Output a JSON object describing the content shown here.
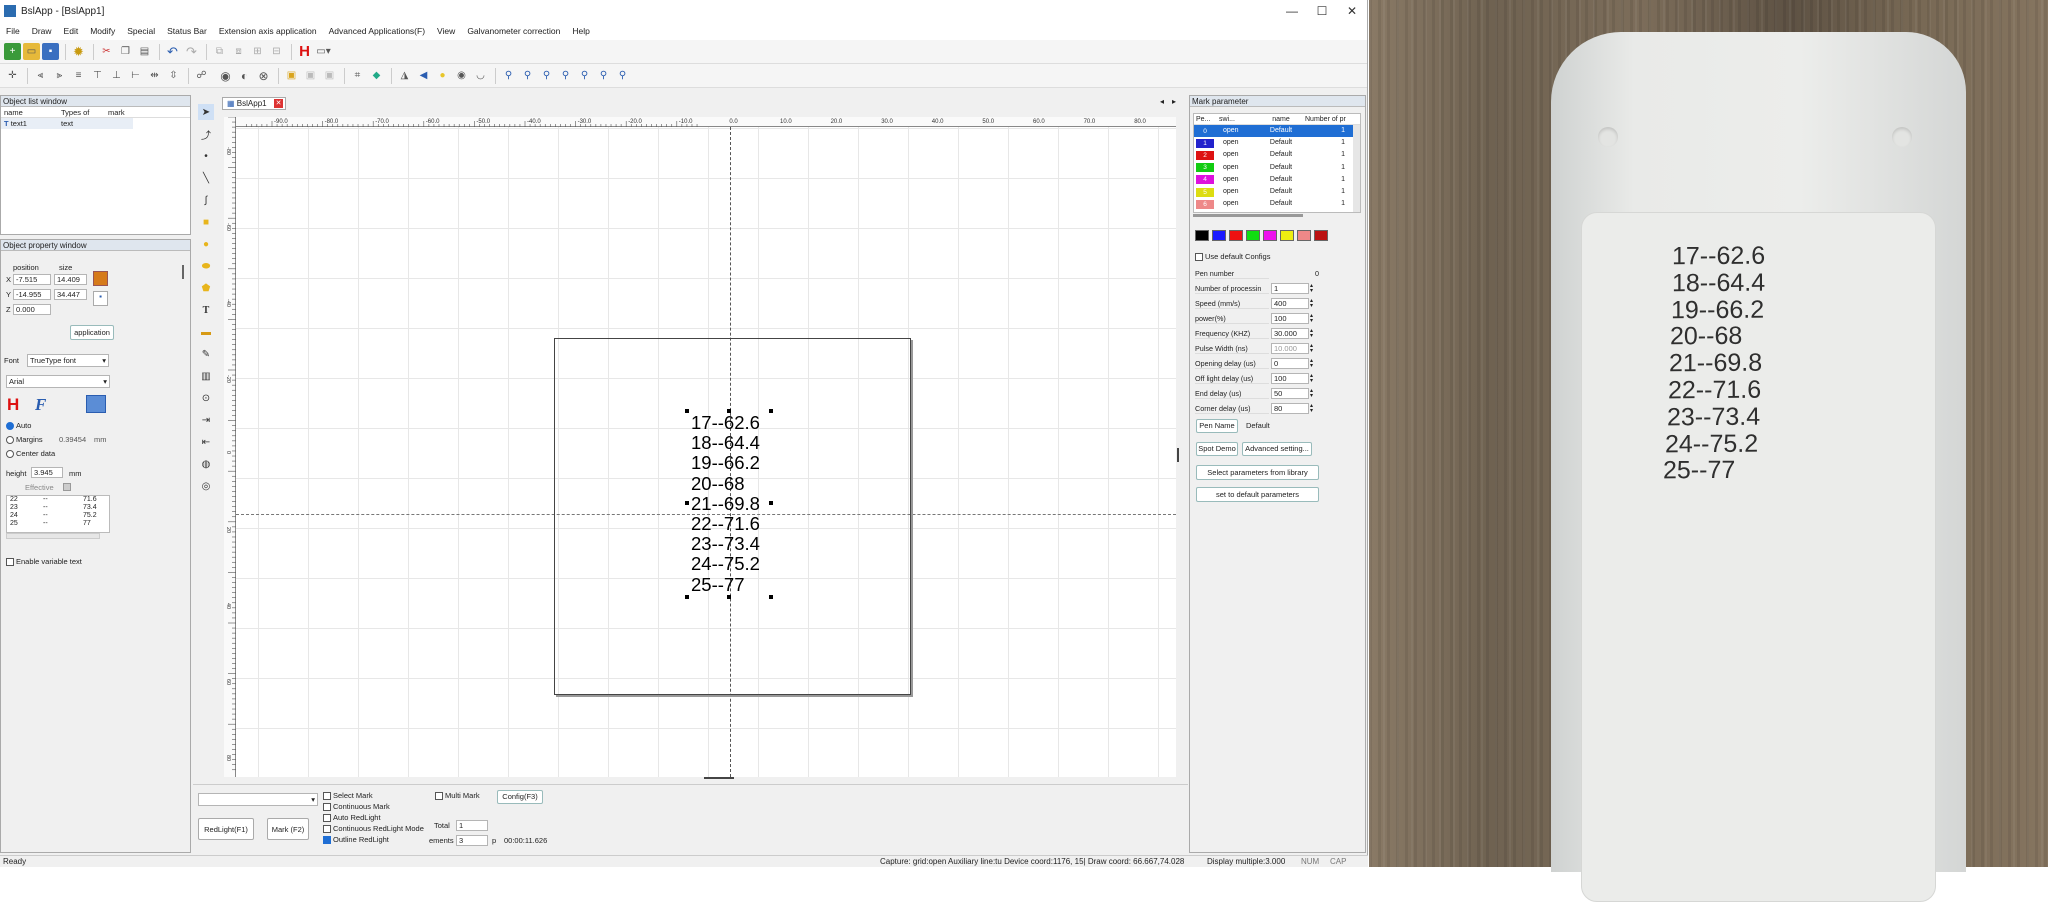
{
  "window": {
    "title": "BslApp - [BslApp1]",
    "minimize": "—",
    "maximize": "☐",
    "close": "✕"
  },
  "menu": [
    "File",
    "Draw",
    "Edit",
    "Modify",
    "Special",
    "Status Bar",
    "Extension axis application",
    "Advanced Applications(F)",
    "View",
    "Galvanometer correction",
    "Help"
  ],
  "object_list": {
    "title": "Object list window",
    "headers": [
      "name",
      "Types of",
      "mark"
    ],
    "rows": [
      {
        "name": "text1",
        "type": "text"
      }
    ]
  },
  "object_property": {
    "title": "Object property window",
    "position_label": "position",
    "size_label": "size",
    "x_label": "X",
    "y_label": "Y",
    "z_label": "Z",
    "x": "-7.515",
    "y": "-14.955",
    "z": "0.000",
    "w": "14.409",
    "h": "34.447",
    "application_button": "application",
    "font_label": "Font",
    "font_type": "TrueType font",
    "font_name": "Arial",
    "auto_label": "Auto",
    "margins_label": "Margins",
    "margins_value": "0.39454",
    "margins_unit": "mm",
    "center_label": "Center data",
    "height_label": "height",
    "height_value": "3.945",
    "height_unit": "mm",
    "effective_label": "Effective",
    "list": [
      [
        "22",
        "--",
        "71.6"
      ],
      [
        "23",
        "--",
        "73.4"
      ],
      [
        "24",
        "--",
        "75.2"
      ],
      [
        "25",
        "--",
        "77"
      ]
    ],
    "variable_text_label": "Enable variable text"
  },
  "doc_tab": "BslApp1",
  "ruler": {
    "top": [
      "-90.0",
      "-80.0",
      "-70.0",
      "-60.0",
      "-50.0",
      "-40.0",
      "-30.0",
      "-20.0",
      "-10.0",
      "0.0",
      "10.0",
      "20.0",
      "30.0",
      "40.0",
      "50.0",
      "60.0",
      "70.0",
      "80.0"
    ],
    "left": [
      "-80",
      "-60",
      "-40",
      "-20",
      "0",
      "20",
      "40",
      "60",
      "80"
    ]
  },
  "mark_text": [
    "17--62.6",
    "18--64.4",
    "19--66.2",
    "20--68",
    "21--69.8",
    "22--71.6",
    "23--73.4",
    "24--75.2",
    "25--77"
  ],
  "bottom": {
    "select_mark": "Select Mark",
    "continuous_mark": "Continuous Mark",
    "auto_redlight": "Auto RedLight",
    "continuous_redlight": "Continuous RedLight Mode",
    "outline_redlight": "Outline RedLight",
    "multi_mark": "Multi Mark",
    "config": "Config(F3)",
    "redlight": "RedLight(F1)",
    "mark": "Mark (F2)",
    "total_label": "Total",
    "total_value": "1",
    "elements_label": "ements",
    "elements_value": "3",
    "p_label": "p",
    "time": "00:00:11.626"
  },
  "mark_param": {
    "title": "Mark parameter",
    "headers": [
      "Pe...",
      "swi...",
      "name",
      "Number of pr"
    ],
    "rows": [
      {
        "num": "0",
        "sw": "open",
        "name": "Default",
        "count": "1",
        "color": "#1f6ed4",
        "sel": true
      },
      {
        "num": "1",
        "sw": "open",
        "name": "Default",
        "count": "1",
        "color": "#2222cc"
      },
      {
        "num": "2",
        "sw": "open",
        "name": "Default",
        "count": "1",
        "color": "#dd1111"
      },
      {
        "num": "3",
        "sw": "open",
        "name": "Default",
        "count": "1",
        "color": "#11cc11"
      },
      {
        "num": "4",
        "sw": "open",
        "name": "Default",
        "count": "1",
        "color": "#dd11dd"
      },
      {
        "num": "5",
        "sw": "open",
        "name": "Default",
        "count": "1",
        "color": "#dddd11"
      },
      {
        "num": "6",
        "sw": "open",
        "name": "Default",
        "count": "1",
        "color": "#ee8888"
      }
    ],
    "swatches": [
      "#000000",
      "#1a1aff",
      "#ee1111",
      "#11dd11",
      "#ee11ee",
      "#eeee11",
      "#ee8888",
      "#bb1111"
    ],
    "use_default": "Use default Configs",
    "fields": [
      {
        "label": "Pen number",
        "value": "0"
      },
      {
        "label": "Number of processin",
        "value": "1"
      },
      {
        "label": "Speed (mm/s)",
        "value": "400"
      },
      {
        "label": "power(%)",
        "value": "100"
      },
      {
        "label": "Frequency (KHZ)",
        "value": "30.000"
      },
      {
        "label": "Pulse Width (ns)",
        "value": "10.000"
      },
      {
        "label": "Opening delay (us)",
        "value": "0"
      },
      {
        "label": "Off light delay (us)",
        "value": "100"
      },
      {
        "label": "End delay (us)",
        "value": "50"
      },
      {
        "label": "Corner delay (us)",
        "value": "80"
      }
    ],
    "pen_name_button": "Pen Name",
    "pen_name_value": "Default",
    "spot_demo": "Spot Demo",
    "advanced": "Advanced setting...",
    "select_library": "Select parameters from library",
    "default_params": "set to default parameters"
  },
  "status": {
    "ready": "Ready",
    "capture": "Capture: grid:open Auxiliary line:tu  Device coord:1176, 15| Draw coord: 66.667,74.028",
    "display": "Display multiple:3.000",
    "num": "NUM",
    "cap": "CAP"
  },
  "photo_text": [
    "17--62.6",
    "18--64.4",
    "19--66.2",
    "20--68",
    "21--69.8",
    "22--71.6",
    "23--73.4",
    "24--75.2",
    "25--77"
  ]
}
